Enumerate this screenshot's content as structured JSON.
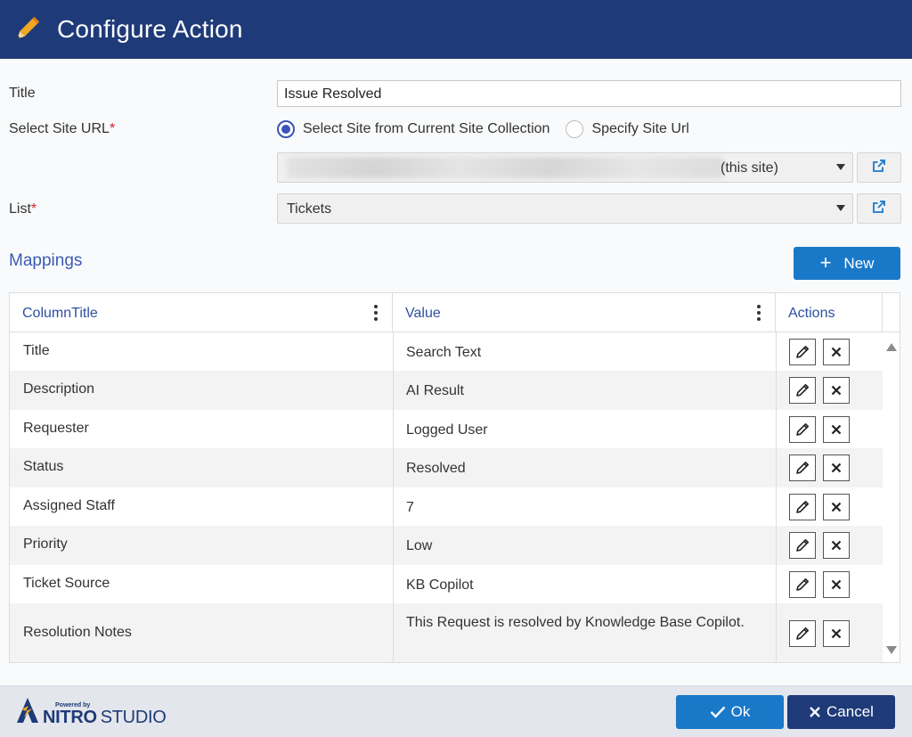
{
  "header": {
    "title": "Configure Action",
    "icon": "pencil-icon",
    "background": "#1e3a78",
    "icon_color": "#f0a824"
  },
  "form": {
    "title_label": "Title",
    "title_value": "Issue Resolved",
    "site_url_label": "Select Site URL",
    "required_mark": "*",
    "radio_current": "Select Site from Current Site Collection",
    "radio_specify": "Specify Site Url",
    "radio_selected": "current",
    "site_select_value": "(this site)",
    "list_label": "List",
    "list_value": "Tickets"
  },
  "mappings": {
    "title": "Mappings",
    "new_button": "New",
    "columns": [
      "ColumnTitle",
      "Value",
      "Actions"
    ],
    "rows": [
      {
        "column": "Title",
        "value": "Search Text"
      },
      {
        "column": "Description",
        "value": "AI Result"
      },
      {
        "column": "Requester",
        "value": "Logged User"
      },
      {
        "column": "Status",
        "value": "Resolved"
      },
      {
        "column": "Assigned Staff",
        "value": "7"
      },
      {
        "column": "Priority",
        "value": "Low"
      },
      {
        "column": "Ticket Source",
        "value": "KB Copilot"
      },
      {
        "column": "Resolution Notes",
        "value": "This Request is resolved by Knowledge Base Copilot."
      }
    ]
  },
  "footer": {
    "logo_powered": "Powered by",
    "logo_nitro": "NITRO",
    "logo_studio": "STUDIO",
    "ok_button": "Ok",
    "cancel_button": "Cancel"
  },
  "colors": {
    "primary": "#1a78c8",
    "dark": "#1e3a78",
    "link": "#2d4fa0",
    "required": "#d0202a"
  }
}
